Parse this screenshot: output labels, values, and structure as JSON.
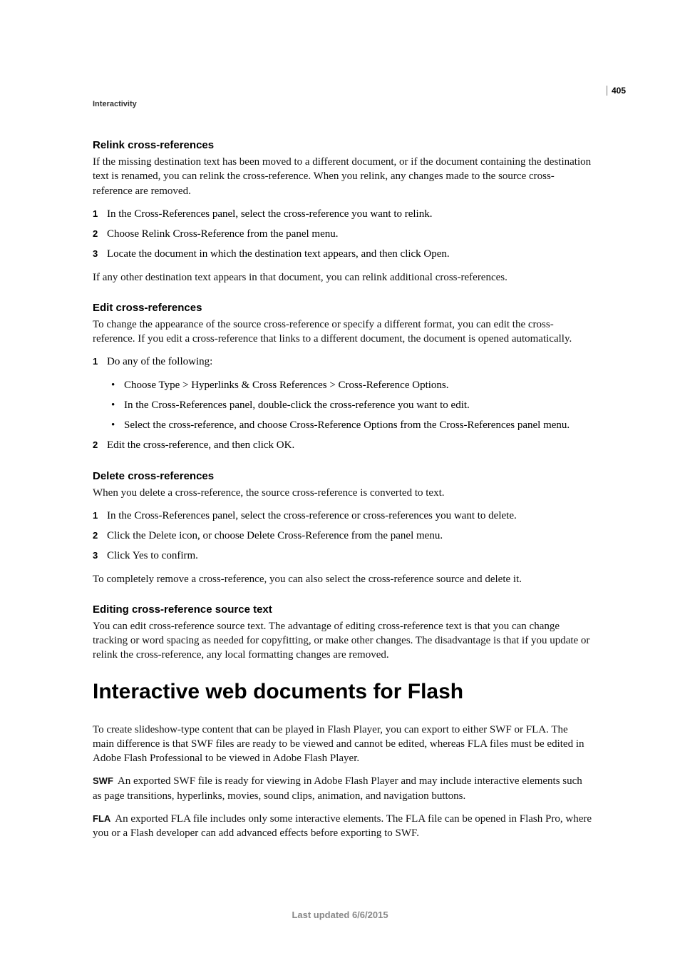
{
  "page_number": "405",
  "header": "Interactivity",
  "sections": [
    {
      "heading": "Relink cross-references",
      "intro": "If the missing destination text has been moved to a different document, or if the document containing the destination text is renamed, you can relink the cross-reference. When you relink, any changes made to the source cross-reference are removed.",
      "steps": [
        "In the Cross-References panel, select the cross-reference you want to relink.",
        "Choose Relink Cross-Reference from the panel menu.",
        "Locate the document in which the destination text appears, and then click Open."
      ],
      "after": "If any other destination text appears in that document, you can relink additional cross-references."
    },
    {
      "heading": "Edit cross-references",
      "intro": "To change the appearance of the source cross-reference or specify a different format, you can edit the cross-reference. If you edit a cross-reference that links to a different document, the document is opened automatically.",
      "step1": "Do any of the following:",
      "sub": [
        "Choose Type > Hyperlinks & Cross References > Cross-Reference Options.",
        "In the Cross-References panel, double-click the cross-reference you want to edit.",
        "Select the cross-reference, and choose Cross-Reference Options from the Cross-References panel menu."
      ],
      "step2": "Edit the cross-reference, and then click OK."
    },
    {
      "heading": "Delete cross-references",
      "intro": "When you delete a cross-reference, the source cross-reference is converted to text.",
      "steps": [
        "In the Cross-References panel, select the cross-reference or cross-references you want to delete.",
        "Click the Delete icon, or choose Delete Cross-Reference from the panel menu.",
        "Click Yes to confirm."
      ],
      "after": "To completely remove a cross-reference, you can also select the cross-reference source and delete it."
    },
    {
      "heading": "Editing cross-reference source text",
      "intro": "You can edit cross-reference source text. The advantage of editing cross-reference text is that you can change tracking or word spacing as needed for copyfitting, or make other changes. The disadvantage is that if you update or relink the cross-reference, any local formatting changes are removed."
    }
  ],
  "h1": "Interactive web documents for Flash",
  "flash_intro": "To create slideshow-type content that can be played in Flash Player, you can export to either SWF or FLA. The main difference is that SWF files are ready to be viewed and cannot be edited, whereas FLA files must be edited in Adobe Flash Professional to be viewed in Adobe Flash Player.",
  "swf_label": "SWF",
  "swf_text": "An exported SWF file is ready for viewing in Adobe Flash Player and may include interactive elements such as page transitions, hyperlinks, movies, sound clips, animation, and navigation buttons.",
  "fla_label": "FLA",
  "fla_text": "An exported FLA file includes only some interactive elements. The FLA file can be opened in Flash Pro, where you or a Flash developer can add advanced effects before exporting to SWF.",
  "footer": "Last updated 6/6/2015",
  "nums": {
    "1": "1",
    "2": "2",
    "3": "3"
  },
  "bullet": "•"
}
